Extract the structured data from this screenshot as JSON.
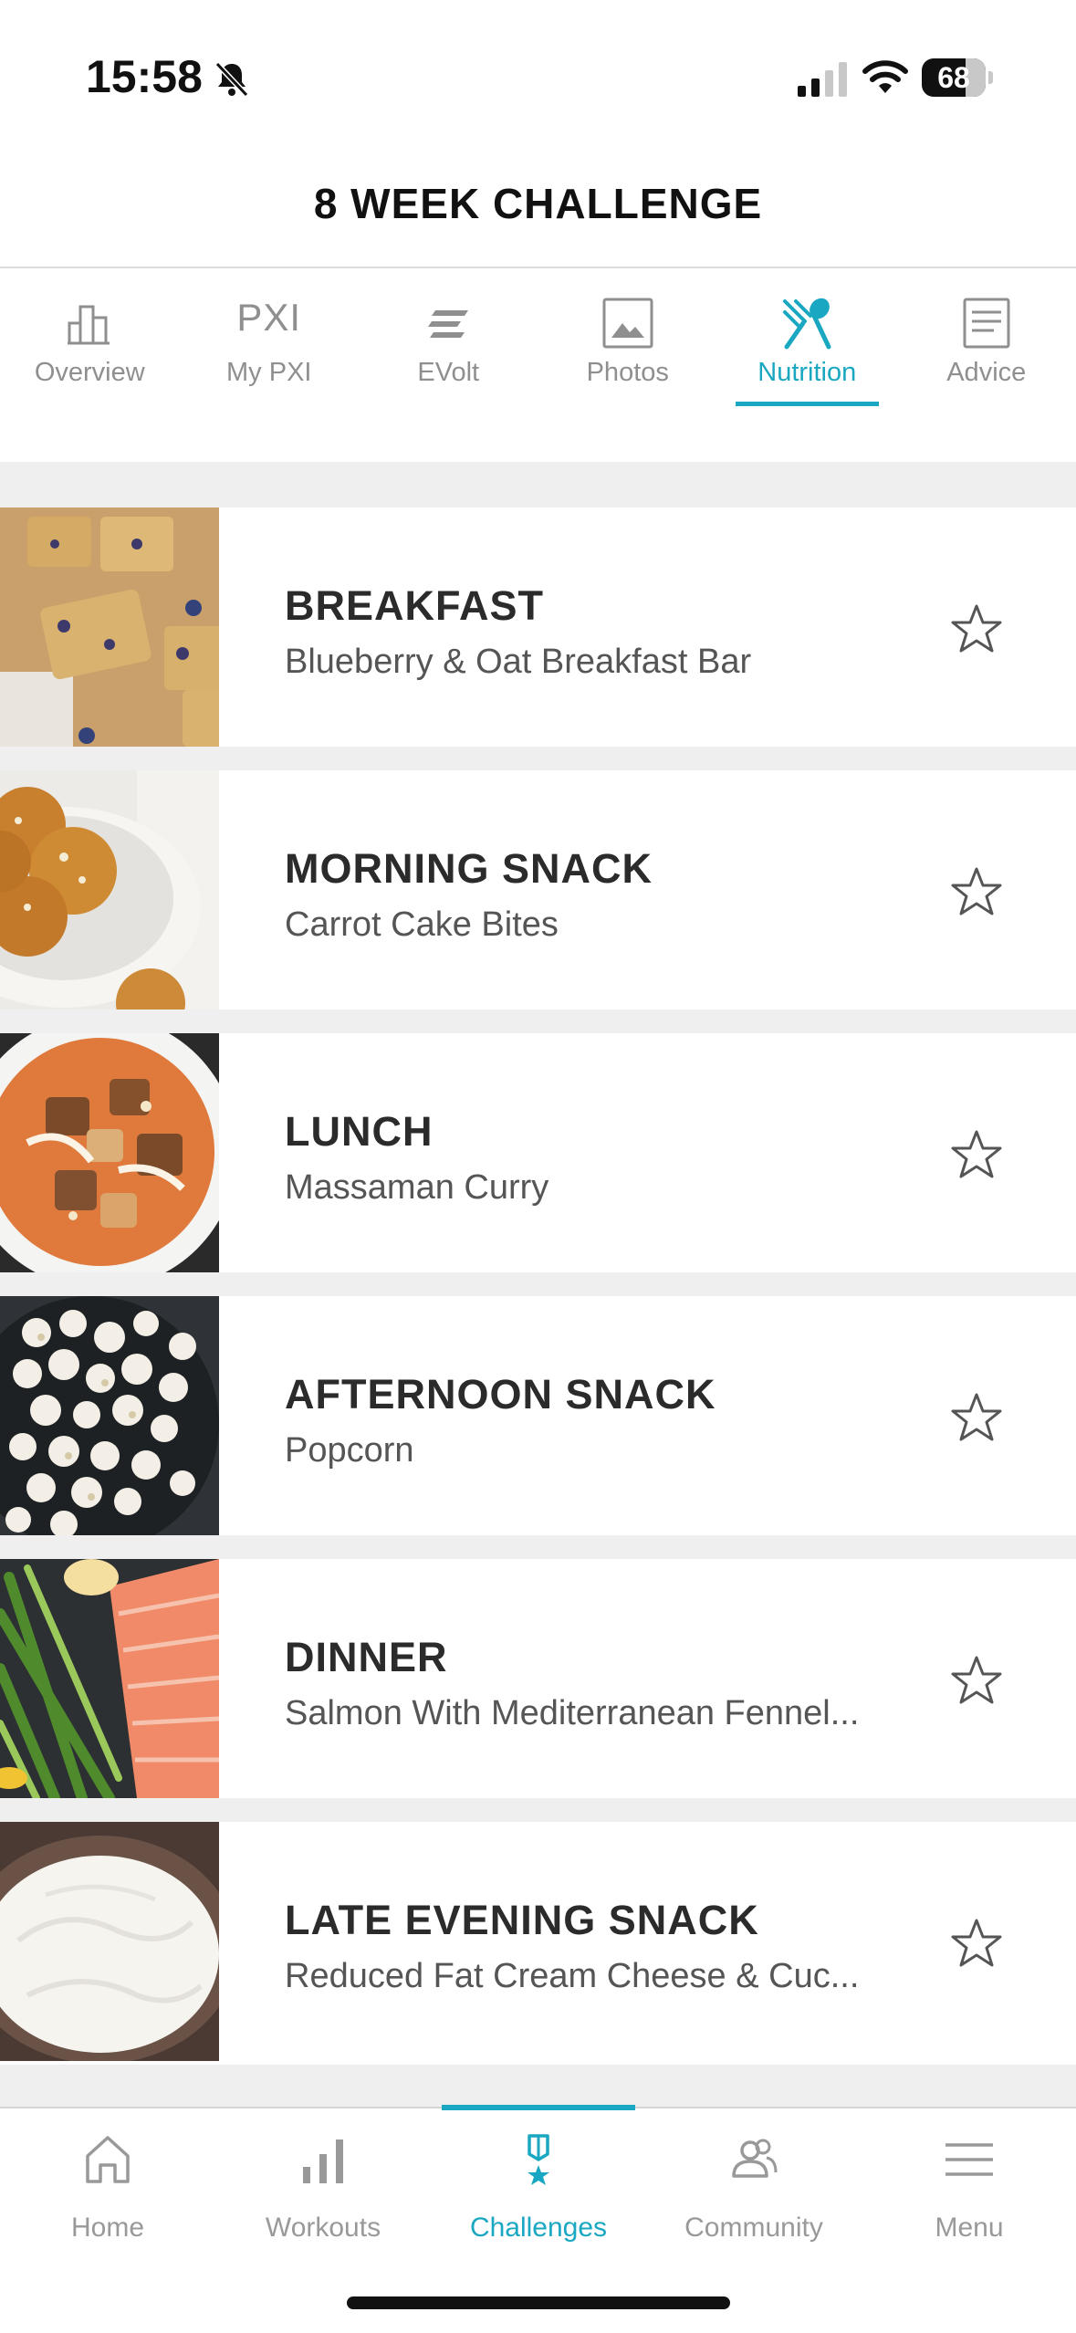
{
  "status_bar": {
    "time": "15:58",
    "battery": "68"
  },
  "header": {
    "title": "8 WEEK CHALLENGE"
  },
  "tabs": [
    {
      "label": "Overview",
      "icon": "bar-chart-icon"
    },
    {
      "label": "My PXI",
      "icon": "pxi-text-icon",
      "icon_text": "PXI"
    },
    {
      "label": "EVolt",
      "icon": "evolt-icon"
    },
    {
      "label": "Photos",
      "icon": "image-icon"
    },
    {
      "label": "Nutrition",
      "icon": "fork-spoon-icon",
      "active": true
    },
    {
      "label": "Advice",
      "icon": "document-icon"
    }
  ],
  "meals": [
    {
      "title": "BREAKFAST",
      "dish": "Blueberry & Oat Breakfast Bar"
    },
    {
      "title": "MORNING SNACK",
      "dish": "Carrot Cake Bites"
    },
    {
      "title": "LUNCH",
      "dish": "Massaman Curry"
    },
    {
      "title": "AFTERNOON SNACK",
      "dish": "Popcorn"
    },
    {
      "title": "DINNER",
      "dish": "Salmon With Mediterranean Fennel..."
    },
    {
      "title": "LATE EVENING SNACK",
      "dish": "Reduced Fat Cream Cheese & Cuc..."
    }
  ],
  "bottom_nav": [
    {
      "label": "Home",
      "icon": "home-icon"
    },
    {
      "label": "Workouts",
      "icon": "bars-icon"
    },
    {
      "label": "Challenges",
      "icon": "medal-icon",
      "active": true
    },
    {
      "label": "Community",
      "icon": "people-icon"
    },
    {
      "label": "Menu",
      "icon": "hamburger-icon"
    }
  ],
  "colors": {
    "accent": "#1aa7c1",
    "inactive": "#8f8f8f",
    "band": "#efefef"
  }
}
